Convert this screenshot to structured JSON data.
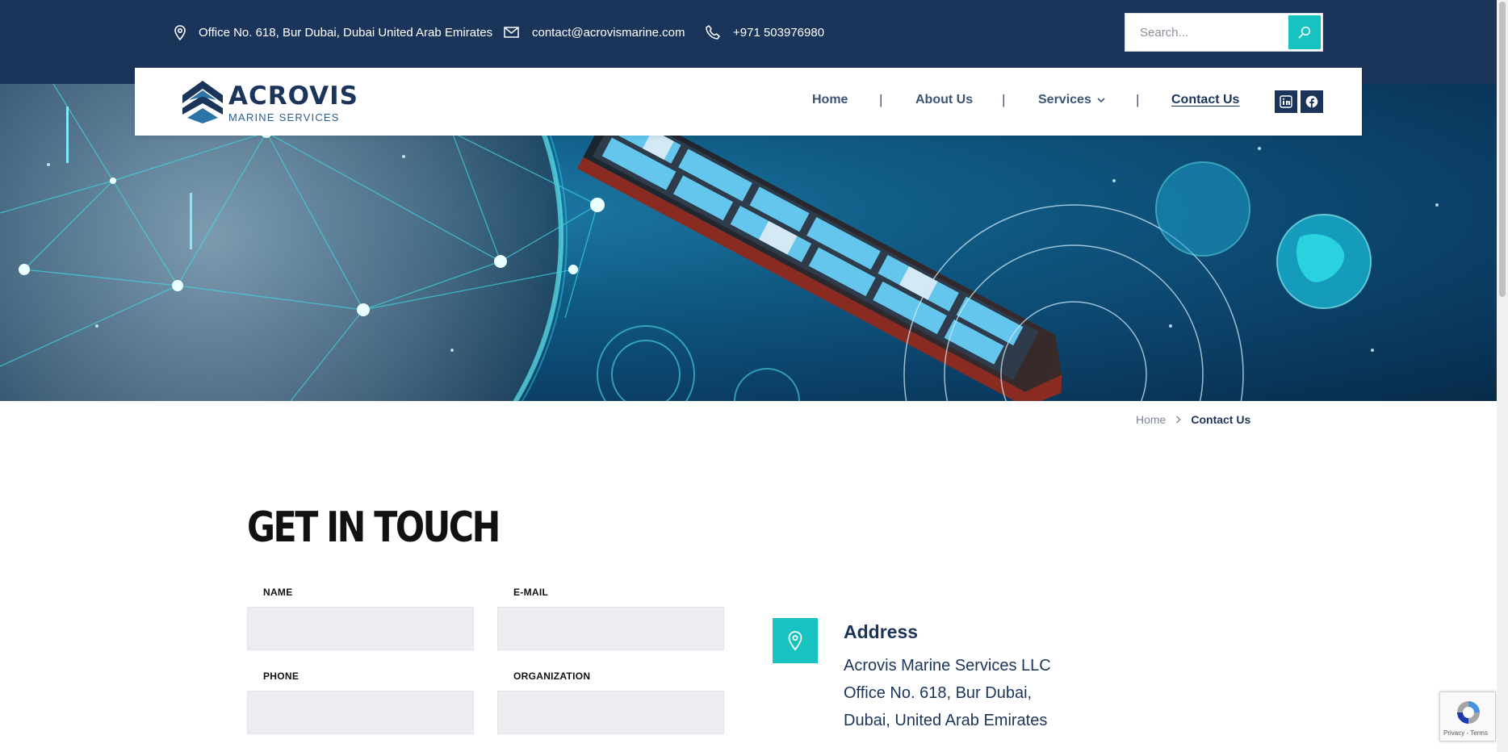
{
  "topbar": {
    "address": "Office No. 618, Bur Dubai, Dubai United Arab Emirates",
    "email": "contact@acrovismarine.com",
    "phone": "+971 503976980",
    "search_placeholder": "Search..."
  },
  "logo": {
    "name": "ACROVIS",
    "tagline": "MARINE SERVICES"
  },
  "nav": {
    "items": [
      {
        "label": "Home"
      },
      {
        "label": "About Us"
      },
      {
        "label": "Services"
      },
      {
        "label": "Contact Us"
      }
    ],
    "separator": "|"
  },
  "breadcrumb": {
    "home": "Home",
    "current": "Contact Us"
  },
  "contact": {
    "heading": "GET IN TOUCH",
    "fields": {
      "name": "NAME",
      "email": "E-MAIL",
      "phone": "PHONE",
      "organization": "ORGANIZATION"
    },
    "address": {
      "title": "Address",
      "lines": [
        "Acrovis Marine Services LLC",
        "Office No. 618, Bur Dubai,",
        "Dubai, United Arab Emirates"
      ]
    }
  },
  "recaptcha": {
    "terms": "Privacy - Terms"
  },
  "colors": {
    "navy": "#1b355a",
    "teal": "#17c3c1"
  }
}
